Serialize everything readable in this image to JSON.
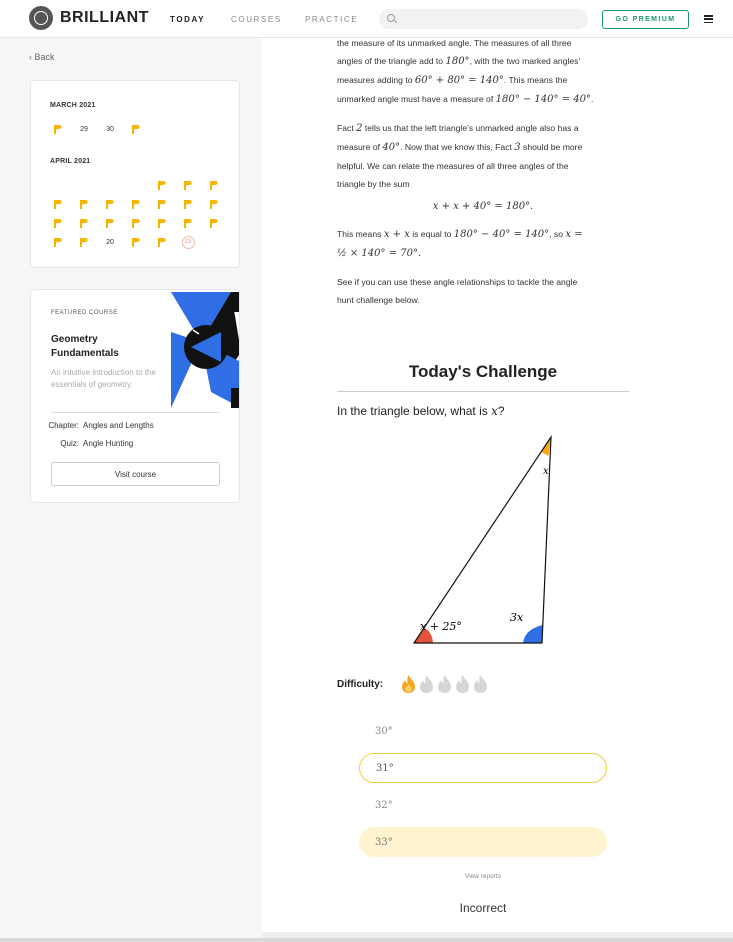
{
  "nav": {
    "logo_text": "BRILLIANT",
    "links": [
      "TODAY",
      "COURSES",
      "PRACTICE"
    ],
    "search_placeholder": "",
    "premium_label": "GO PREMIUM",
    "icons": [
      "logo-icon",
      "search-icon",
      "hamburger-menu-icon"
    ]
  },
  "sidebar": {
    "back_label": "Back",
    "calendar": {
      "months": [
        "MARCH 2021",
        "APRIL 2021"
      ],
      "march_days": [
        "29",
        "30"
      ],
      "april_days": [
        "20",
        "23"
      ]
    },
    "course": {
      "featured_label": "FEATURED COURSE",
      "title": "Geometry Fundamentals",
      "description": "An intuitive introduction to the essentials of geometry.",
      "chapter_label": "Chapter:",
      "chapter_value": "Angles and Lengths",
      "quiz_label": "Quiz:",
      "quiz_value": "Angle Hunting",
      "visit_label": "Visit course"
    }
  },
  "content": {
    "p1": {
      "l1": "the measure of its unmarked angle. The measures of all three",
      "l2a": "angles of the triangle add to ",
      "l2m": "180°",
      "l2b": ", with the two marked angles'",
      "l3a": "measures adding to ",
      "l3m": "60° + 80° = 140°",
      "l3b": ". This means the",
      "l4a": "unmarked angle must have a measure of ",
      "l4m": "180° − 140° = 40°",
      "l4b": "."
    },
    "p2": {
      "l1a": "Fact ",
      "l1m": "2",
      "l1b": " tells us that the left triangle's unmarked angle also has a",
      "l2a": "measure of ",
      "l2m": "40°",
      "l2b": ". Now that we know this, Fact ",
      "l2m2": "3",
      "l2c": " should be more",
      "l3": "helpful. We can relate the measures of all three angles of the",
      "l4": "triangle by the sum"
    },
    "equation": "x + x + 40° = 180°.",
    "p3": {
      "l1a": "This means ",
      "l1m": "x + x",
      "l1b": " is equal to ",
      "l1m2": "180° − 40° = 140°",
      "l1c": ", so ",
      "l1m3": "x =",
      "l2m": "½ × 140° = 70°."
    },
    "p4": {
      "l1": "See if you can use these angle relationships to tackle the angle",
      "l2": "hunt challenge below."
    }
  },
  "challenge": {
    "title": "Today's Challenge",
    "question_prefix": "In the triangle below, what is ",
    "question_var": "x",
    "question_suffix": "?",
    "triangle_labels": {
      "top": "x",
      "bottom_left": "x + 25°",
      "bottom_right": "3x"
    },
    "colors": {
      "top_angle": "#f2a81d",
      "bottom_left_angle": "#e5533d",
      "bottom_right_angle": "#2f6ee5"
    },
    "difficulty_label": "Difficulty:",
    "difficulty_level": 1,
    "difficulty_max": 5,
    "options": [
      "30°",
      "31°",
      "32°",
      "33°"
    ],
    "view_reports": "View reports",
    "result": "Incorrect"
  }
}
